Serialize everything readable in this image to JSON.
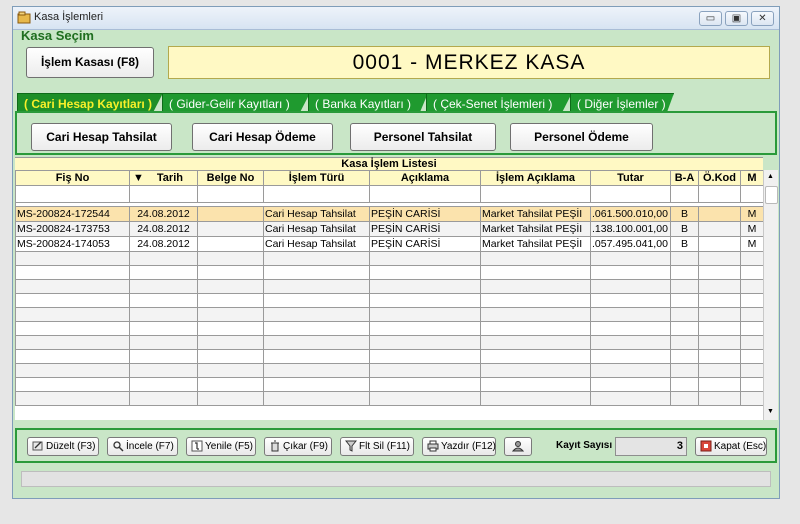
{
  "window": {
    "title": "Kasa İşlemleri",
    "controls": [
      "minimize-icon",
      "restore-icon",
      "close-icon"
    ]
  },
  "kasa_secim": {
    "label": "Kasa Seçim",
    "button_label": "İşlem Kasası (F8)",
    "current_kasa": "0001  -  MERKEZ KASA"
  },
  "tabs": [
    {
      "label": "( Cari Hesap Kayıtları )",
      "active": true
    },
    {
      "label": "( Gider-Gelir Kayıtları )",
      "active": false
    },
    {
      "label": "( Banka Kayıtları )",
      "active": false
    },
    {
      "label": "( Çek-Senet İşlemleri )",
      "active": false
    },
    {
      "label": "( Diğer İşlemler )",
      "active": false
    }
  ],
  "actions": {
    "cari_tahsilat": "Cari Hesap Tahsilat",
    "cari_odeme": "Cari Hesap Ödeme",
    "personel_tahsilat": "Personel Tahsilat",
    "personel_odeme": "Personel Ödeme"
  },
  "grid": {
    "title": "Kasa İşlem Listesi",
    "columns": [
      "Fiş No",
      "Tarih",
      "Belge No",
      "İşlem Türü",
      "Açıklama",
      "İşlem Açıklama",
      "Tutar",
      "B-A",
      "Ö.Kod",
      "M"
    ],
    "sort_indicator": "▼",
    "rows": [
      [
        "MS-200824-172544",
        "24.08.2012",
        "",
        "Cari Hesap Tahsilat",
        "PEŞİN CARİSİ",
        "Market Tahsilat PEŞİI",
        ".061.500.010,00",
        "B",
        "",
        "M"
      ],
      [
        "MS-200824-173753",
        "24.08.2012",
        "",
        "Cari Hesap Tahsilat",
        "PEŞİN CARİSİ",
        "Market Tahsilat PEŞİI",
        ".138.100.001,00",
        "B",
        "",
        "M"
      ],
      [
        "MS-200824-174053",
        "24.08.2012",
        "",
        "Cari Hesap Tahsilat",
        "PEŞİN CARİSİ",
        "Market Tahsilat PEŞİI",
        ".057.495.041,00",
        "B",
        "",
        "M"
      ]
    ]
  },
  "bottom": {
    "duzelt": "Düzelt (F3)",
    "incele": "İncele (F7)",
    "yenile": "Yenile (F5)",
    "cikar": "Çıkar (F9)",
    "flt_sil": "Flt Sil (F11)",
    "yazdir": "Yazdır (F12)",
    "kayit_label": "Kayıt Sayısı",
    "kayit_value": "3",
    "kapat": "Kapat (Esc)"
  },
  "colors": {
    "panel": "#c9e6c7",
    "tab": "#1f9a2f",
    "active_tab_text": "#f8ef2a",
    "header": "#fff9c4",
    "highlight_row": "#fbe3ad"
  }
}
